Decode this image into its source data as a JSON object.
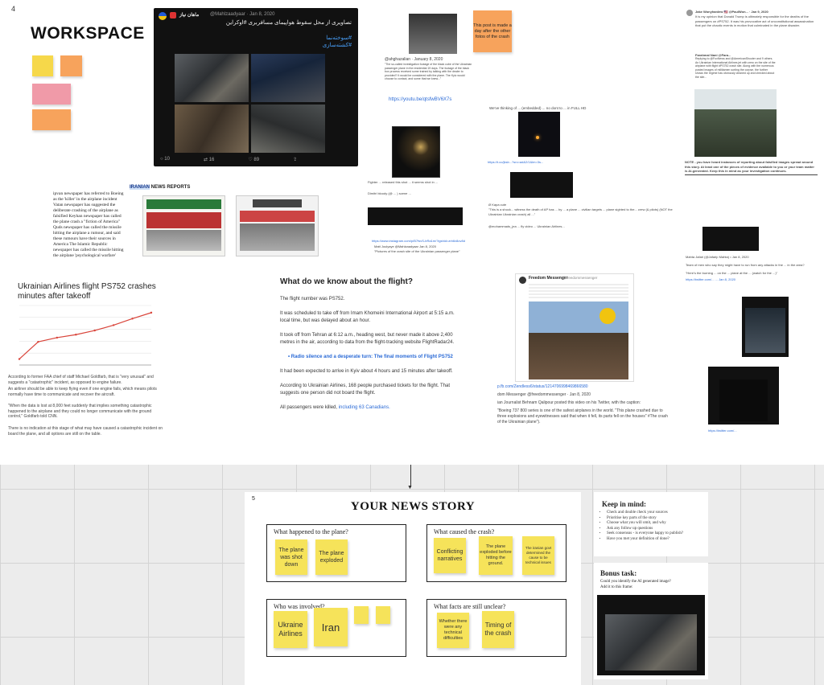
{
  "frame_numbers": {
    "workspace": "4",
    "story": "5"
  },
  "workspace": {
    "title": "WORKSPACE"
  },
  "main_tweet": {
    "username": "ماهان نیاز",
    "handle_date": "@Mahlzaadyaar · Jan 8, 2020",
    "text": "تصاویری از محل سقوط هواپیمای مسافربری #اوکراین",
    "hashtag1": "#سوخته‌نما",
    "hashtag2": "#کشته‌سازی",
    "replies": "10",
    "retweets": "16",
    "likes": "89"
  },
  "newspapers": {
    "header_prefix": "IRANIAN",
    "header_rest": " NEWS REPORTS",
    "body": "ipvan newspaper has referred to Boeing as the 'killer' in the airplane incident Vatan newspaper has suggested the deliberate crashing of the airplane as falsified Keyhan newspaper has called the plane crash a \"fiction of America\" Quds newspaper has called the missile hitting the airplane a rumour, and said these rumours have their sources in America The Islamic Republic newspaper has called the missile hitting the airplane 'psychological warfare'"
  },
  "center_col": {
    "small1": "@ahghazalian · January 8, 2020",
    "small2": "\"The so-called investigation footage of the black cube of the Ukrainian passenger plane in the residential 19 days. The footage of the black box process received some trained by talking with the dealer to provided? It would be considered with the plane. The Kyiv would choose to contact, and some that we knew...\"",
    "link": "https://youtu.be/qtsfwBV6X7s",
    "caption1": "Fighter ... released this shot ... it seems shot in ...",
    "caption2": "Dimitri bloody (@ ... ) scene ...",
    "bottom_link": "https://www.instagram.com/p/B7fsvS-bRa1m/?igshid=zrb6v8ov8d",
    "bottom_caption1": "Matt Joulyaye @Mahlzaadyaar Jan 8, 2020",
    "bottom_caption2": "\"Pictures of the crash site of the Ukrainian passenger plane\""
  },
  "sticky_note": "This post is made a day after the other fotos of the crash",
  "right_col": {
    "tweet1_name": "Jake Wonyhanlew 🇺🇸 @PaulWon... · Jan 9, 2020",
    "tweet1_text": "It is my opinion that Donald Trump is ultimately responsible for the deaths of the passengers on #PS752. It was his provocative act of unconstitutional assassination that put the chaotic events in motion that culminated in the plane disaster.",
    "tweet2_name": "Farahmal Nani @Fara...",
    "tweet2_text": "Replying to @FoxNews and @AmericanShooter and 9 others. An Ukrainian International Airlines jet with crew on the site of the airplane with flight #PS752 crash site. Along with the numerous posted images of militiamen sorting the corpse, the further shows the regime has obviously cleaned up and checked about the site...",
    "note_text": "NOTE - you have heard instances of reporting about falsified images spread around this story. At least one of the pieces of evidence available to you or your team matter is AI-generated. Keep this in mind as your investigation continues.",
    "mid_caption": "We've thinking of ... (embedded) ... no dont to ... in FULL HD",
    "mid_link": "https://t.co/jksb...?src=ad&2/1&lm=3s...",
    "caption_b1": "\"This is a shock... witness the death of AP has ... by ... a plane ... civilian targets ... plane sighted to the... crew (& pilots) (NOT the Ukrainian Ukrainian crash) all ...\"",
    "caption_b2": "@mohammads_jea ... fly video ... Ukrainian Airlines...",
    "caption_c1": "Mahta Jafari (@Jafarip Mahta) • Jan 8, 2020",
    "caption_c2": "Team of men who say they might have to run from any attacks in the ... in the area?",
    "caption_c3": "\"Here's the burning ... on the ... plane at the ... (watch for the ...)\"",
    "caption_c4": "https://twitter.com/... ... Jan 8, 2020"
  },
  "chart": {
    "title": "Ukrainian Airlines flight PS752 crashes minutes after takeoff",
    "body1": "According to former FAA chief of staff Michael Goldfarb, that is \"very unusual\" and suggests a \"catastrophic\" incident, as opposed to engine failure.",
    "body2": "An airliner should be able to keep flying even if one engine fails, which means pilots normally have time to communicate and recover the aircraft.",
    "body3": "\"When the data is lost at 8,000 feet suddenly that implies something catastrophic happened to the airplane and they could no longer communicate with the ground control,\" Goldfarb told CNN.",
    "body4": "There is no indication at this stage of what may have caused a catastrophic incident on board the plane, and all options are still on the table."
  },
  "chart_data": {
    "type": "line",
    "title": "Ukrainian Airlines flight PS752 crashes minutes after takeoff",
    "x": [
      0,
      1,
      2,
      3,
      4,
      5,
      6,
      7
    ],
    "values": [
      1,
      3.9,
      4.6,
      5.1,
      5.8,
      6.7,
      7.8,
      8.8
    ],
    "ylim": [
      0,
      10
    ]
  },
  "article": {
    "title": "What do we know about the flight?",
    "p1": "The flight number was PS752.",
    "p2": "It was scheduled to take off from Imam Khomeini International Airport at 5:15 a.m. local time, but was delayed about an hour.",
    "p3": "It took off from Tehran at 6:12 a.m., heading west, but never made it above 2,400 metres in the air, according to data from the flight-tracking website FlightRadar24.",
    "p4_link": "Radio silence and a desperate turn: The final moments of Flight PS752",
    "p5": "It had been expected to arrive in Kyiv about 4 hours and 15 minutes after takeoff.",
    "p6": "According to Ukrainian Airlines, 168 people purchased tickets for the flight. That suggests one person did not board the flight.",
    "p7_text": "All passengers were killed, ",
    "p7_link": "including 63 Canadians."
  },
  "freedom": {
    "name": "Freedom Messenger",
    "handle": "@freedommessenger",
    "link": "p.fb.com/Zendless6/status/1214706998469866580",
    "caption1": "dom Messenger @freedommessenger · Jan 8, 2020",
    "caption2": "ian Journalist Behnam Qalipour posted this video on his Twitter, with the caption:",
    "caption3": "\"Boeing 737 800 series is one of the safest airplanes in the world. \"This plane crashed due to three explosions and eyewitnesses said that when it fell, its parts fell on the houses\" #The crash of the Ukrainian plane\")."
  },
  "story": {
    "title": "YOUR NEWS STORY",
    "boxes": [
      {
        "label": "What happened to the plane?",
        "notes": [
          "The plane was shot down",
          "The plane exploded"
        ]
      },
      {
        "label": "What caused the crash?",
        "notes": [
          "Conflicting narratives",
          "The plane exploded before hitting the ground.",
          "The iranian govt determined the cause to be technical issues"
        ]
      },
      {
        "label": "Who was involved?",
        "notes": [
          "Ukraine Airlines",
          "Iran"
        ]
      },
      {
        "label": "What facts are still unclear?",
        "notes": [
          "Whether there were any technical difficulties",
          "Timing of the crash"
        ]
      }
    ]
  },
  "keep_in_mind": {
    "title": "Keep in mind:",
    "items": [
      "Check and double check your sources",
      "Prioritise key parts of the story",
      "Choose what you will omit, and why",
      "Ask any follow up questions",
      "Seek consensus - is everyone happy to publish?",
      "Have you met your definition of done?"
    ]
  },
  "bonus": {
    "title": "Bonus task:",
    "text1": "Could you identify the AI generated image?",
    "text2": "Add it to this frame:"
  },
  "colors": {
    "sticky_yellow": "#f6e35a",
    "sticky_orange": "#f7a35c",
    "sticky_pink": "#f09aa8",
    "link_blue": "#2a6ad6",
    "chart_line": "#d9443a"
  }
}
